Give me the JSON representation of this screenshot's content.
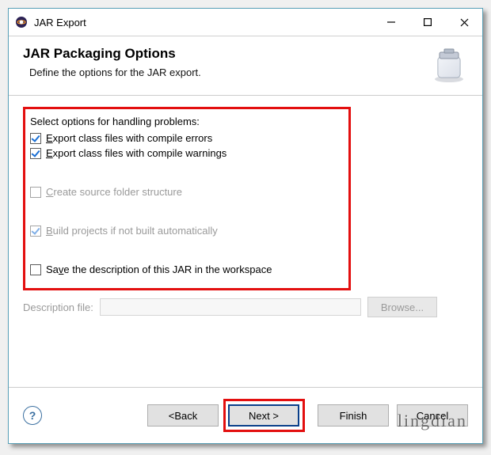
{
  "window": {
    "title": "JAR Export"
  },
  "banner": {
    "heading": "JAR Packaging Options",
    "description": "Define the options for the JAR export."
  },
  "options": {
    "section_label": "Select options for handling problems:",
    "export_errors": {
      "label_prefix": "",
      "label": "Export class files with compile errors",
      "accel": "E",
      "checked": true,
      "enabled": true
    },
    "export_warnings": {
      "label": "Export class files with compile warnings",
      "accel_pos": 0,
      "checked": true,
      "enabled": true
    },
    "create_source": {
      "label": "Create source folder structure",
      "checked": false,
      "enabled": false
    },
    "build_projects": {
      "label": "Build projects if not built automatically",
      "checked": true,
      "enabled": false
    },
    "save_description": {
      "label": "Save the description of this JAR in the workspace",
      "checked": false,
      "enabled": true
    }
  },
  "description_row": {
    "label": "Description file:",
    "value": "",
    "browse_label": "Browse..."
  },
  "footer": {
    "back": "< Back",
    "next": "Next >",
    "finish": "Finish",
    "cancel": "Cancel"
  },
  "watermark": "lingdian"
}
